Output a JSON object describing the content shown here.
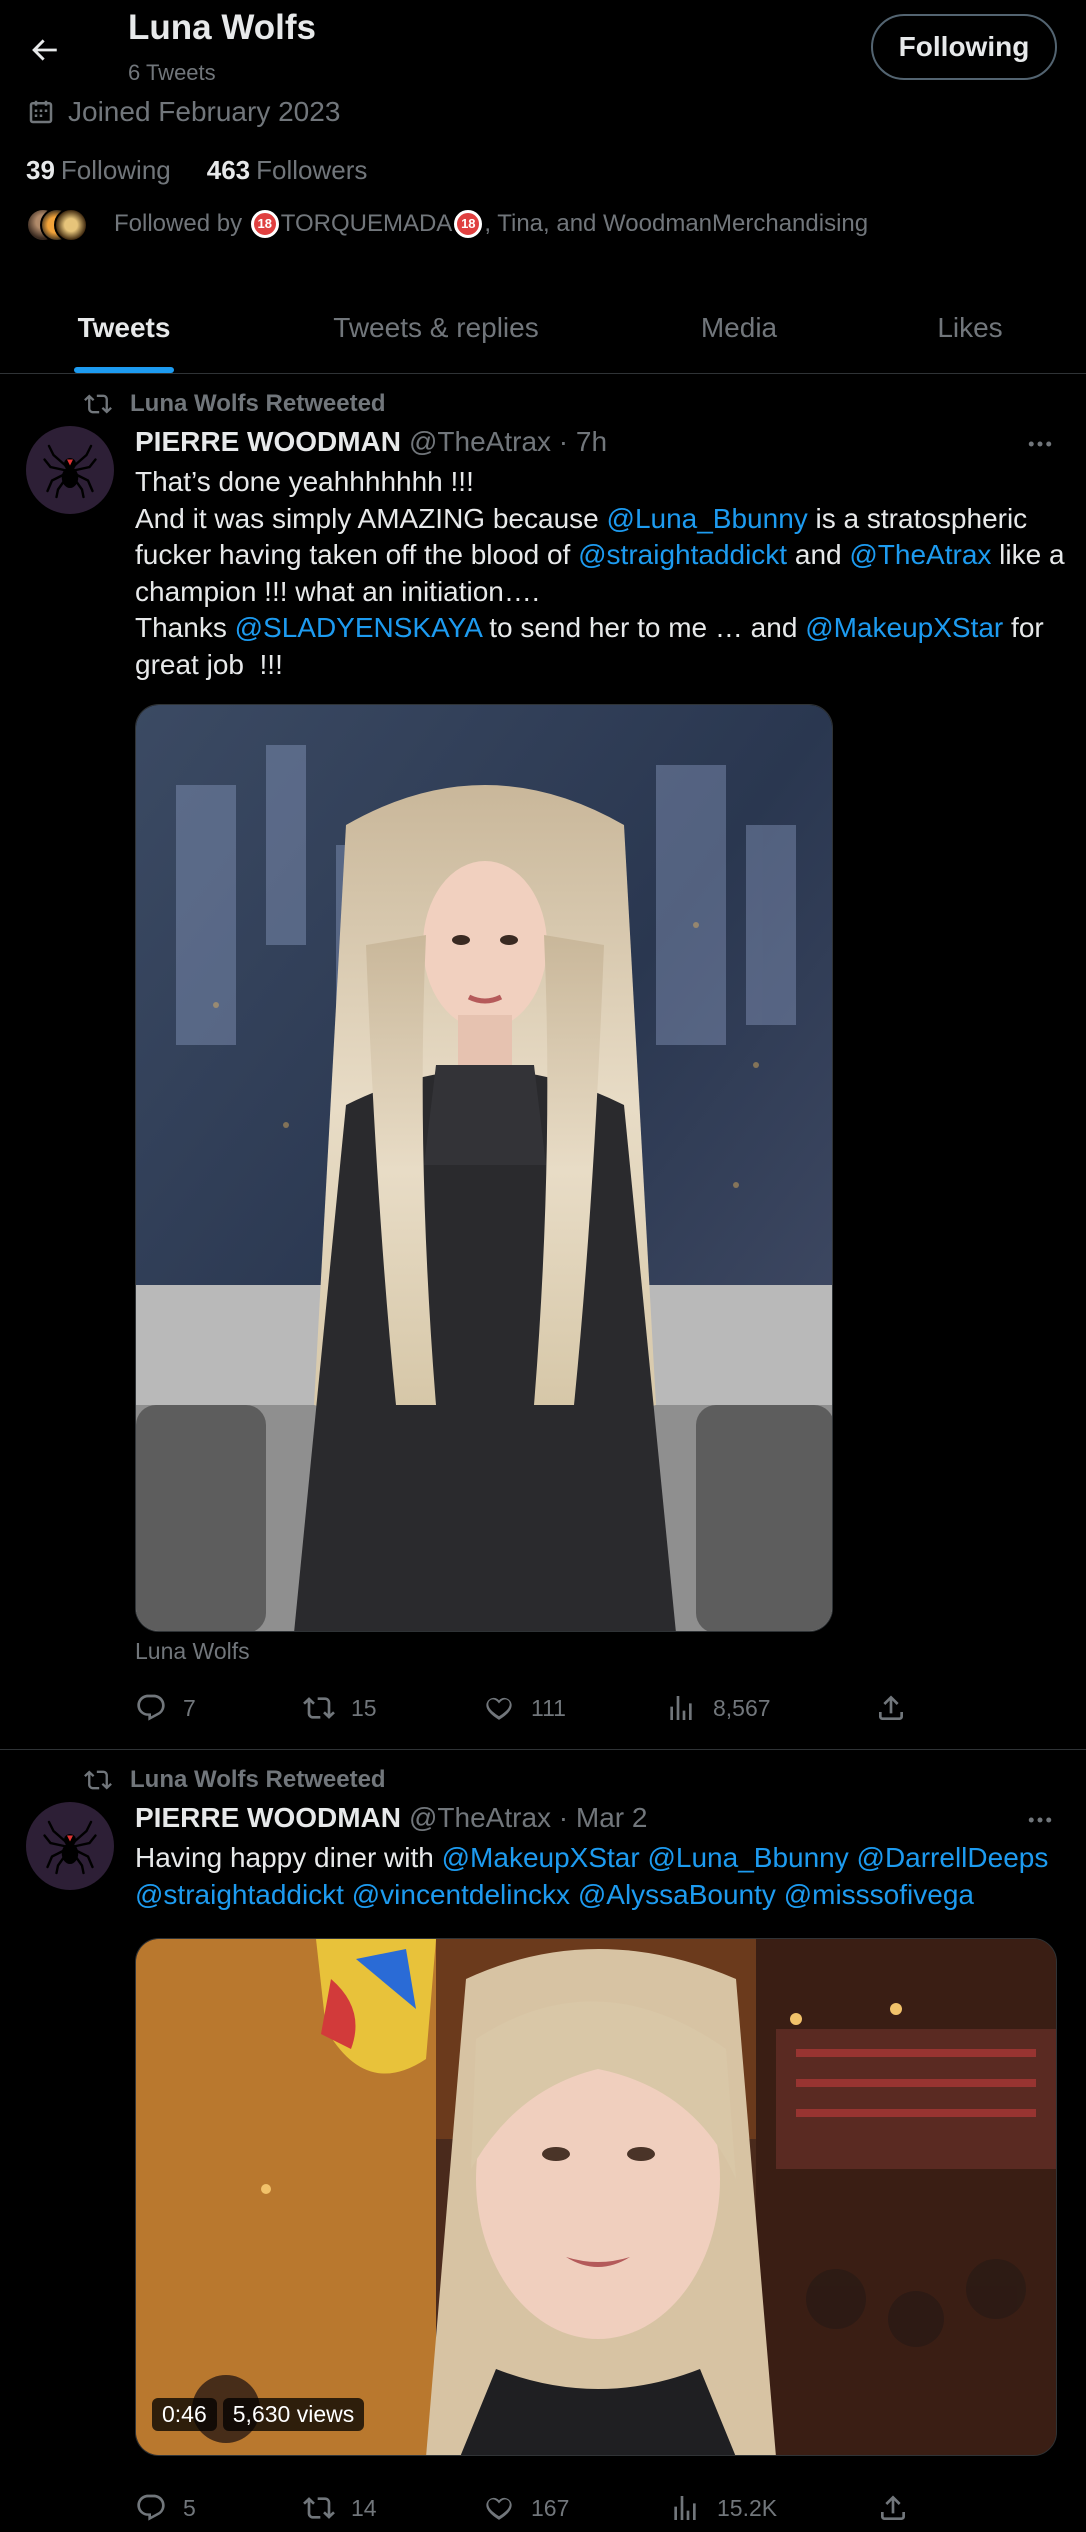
{
  "header": {
    "name": "Luna Wolfs",
    "tweet_count": "6 Tweets",
    "follow_button": "Following",
    "joined": "Joined February 2023",
    "following_count": "39",
    "following_label": "Following",
    "followers_count": "463",
    "followers_label": "Followers",
    "followed_by_prefix": "Followed by ",
    "followed_by_badge": "18",
    "followed_by_name": "TORQUEMADA",
    "followed_by_suffix": ", Tina, and WoodmanMerchandising"
  },
  "tabs": [
    "Tweets",
    "Tweets & replies",
    "Media",
    "Likes"
  ],
  "tweets": [
    {
      "retweeted_by": "Luna Wolfs Retweeted",
      "author": "PIERRE WOODMAN",
      "handle_time": "@TheAtrax · 7h",
      "text": [
        [
          "t",
          "That’s done yeahhhhhhh !!!\nAnd it was simply AMAZING because "
        ],
        [
          "m",
          "@Luna_Bbunny"
        ],
        [
          "t",
          " is a stratospheric fucker having taken off the blood of "
        ],
        [
          "m",
          "@straightaddickt"
        ],
        [
          "t",
          " and "
        ],
        [
          "m",
          "@TheAtrax"
        ],
        [
          "t",
          " like a champion !!! what an initiation….\nThanks "
        ],
        [
          "m",
          "@SLADYENSKAYA"
        ],
        [
          "t",
          " to send her to me … and "
        ],
        [
          "m",
          "@MakeupXStar"
        ],
        [
          "t",
          " for great job  !!!"
        ]
      ],
      "media_caption": "Luna Wolfs",
      "replies": "7",
      "retweets": "15",
      "likes": "111",
      "views": "8,567"
    },
    {
      "retweeted_by": "Luna Wolfs Retweeted",
      "author": "PIERRE WOODMAN",
      "handle_time": "@TheAtrax · Mar 2",
      "text": [
        [
          "t",
          "Having happy diner with "
        ],
        [
          "m",
          "@MakeupXStar"
        ],
        [
          "t",
          " "
        ],
        [
          "m",
          "@Luna_Bbunny"
        ],
        [
          "t",
          " "
        ],
        [
          "m",
          "@DarrellDeeps"
        ],
        [
          "t",
          " "
        ],
        [
          "m",
          "@straightaddickt"
        ],
        [
          "t",
          " "
        ],
        [
          "m",
          "@vincentdelinckx"
        ],
        [
          "t",
          " "
        ],
        [
          "m",
          "@AlyssaBounty"
        ],
        [
          "t",
          " "
        ],
        [
          "m",
          "@misssofivega"
        ]
      ],
      "video_duration": "0:46",
      "video_views": "5,630 views",
      "replies": "5",
      "retweets": "14",
      "likes": "167",
      "views": "15.2K"
    }
  ],
  "colors": {
    "background": "#000000",
    "text": "#e7e9ea",
    "muted": "#71767b",
    "accent": "#1d9bf0",
    "divider": "#2f3336"
  },
  "icons": [
    "back-arrow-icon",
    "calendar-icon",
    "retweet-icon",
    "more-icon",
    "reply-icon",
    "like-icon",
    "views-icon",
    "share-icon"
  ]
}
